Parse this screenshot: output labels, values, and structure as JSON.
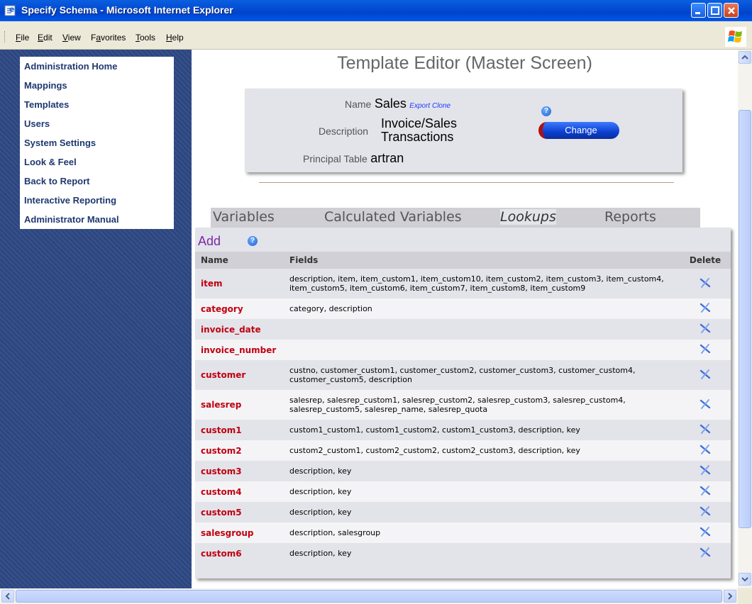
{
  "window": {
    "title": "Specify Schema - Microsoft Internet Explorer"
  },
  "menu": [
    {
      "pre": "",
      "key": "F",
      "post": "ile"
    },
    {
      "pre": "",
      "key": "E",
      "post": "dit"
    },
    {
      "pre": "",
      "key": "V",
      "post": "iew"
    },
    {
      "pre": "F",
      "key": "a",
      "post": "vorites"
    },
    {
      "pre": "",
      "key": "T",
      "post": "ools"
    },
    {
      "pre": "",
      "key": "H",
      "post": "elp"
    }
  ],
  "sidebar": {
    "items": [
      "Administration Home",
      "Mappings",
      "Templates",
      "Users",
      "System Settings",
      "Look & Feel",
      "Back to Report",
      "Interactive Reporting",
      "Administrator Manual"
    ]
  },
  "page": {
    "title": "Template Editor (Master Screen)"
  },
  "info": {
    "name_label": "Name",
    "name_value": "Sales",
    "export_clone": "Export Clone",
    "description_label": "Description",
    "description_line1": "Invoice/Sales",
    "description_line2": "Transactions",
    "principal_label": "Principal Table",
    "principal_value": "artran",
    "help": "?",
    "change_button": "Change"
  },
  "tabs": [
    "Variables",
    "Calculated Variables",
    "Lookups",
    "Reports"
  ],
  "lookups": {
    "add_label": "Add",
    "help": "?",
    "columns": {
      "name": "Name",
      "fields": "Fields",
      "delete": "Delete"
    },
    "rows": [
      {
        "name": "item",
        "fields": "description, item, item_custom1, item_custom10, item_custom2, item_custom3, item_custom4, item_custom5, item_custom6, item_custom7, item_custom8, item_custom9"
      },
      {
        "name": "category",
        "fields": "category, description"
      },
      {
        "name": "invoice_date",
        "fields": ""
      },
      {
        "name": "invoice_number",
        "fields": ""
      },
      {
        "name": "customer",
        "fields": "custno, customer_custom1, customer_custom2, customer_custom3, customer_custom4, customer_custom5, description"
      },
      {
        "name": "salesrep",
        "fields": "salesrep, salesrep_custom1, salesrep_custom2, salesrep_custom3, salesrep_custom4, salesrep_custom5, salesrep_name, salesrep_quota"
      },
      {
        "name": "custom1",
        "fields": "custom1_custom1, custom1_custom2, custom1_custom3, description, key"
      },
      {
        "name": "custom2",
        "fields": "custom2_custom1, custom2_custom2, custom2_custom3, description, key"
      },
      {
        "name": "custom3",
        "fields": "description, key"
      },
      {
        "name": "custom4",
        "fields": "description, key"
      },
      {
        "name": "custom5",
        "fields": "description, key"
      },
      {
        "name": "salesgroup",
        "fields": "description, salesgroup"
      },
      {
        "name": "custom6",
        "fields": "description, key"
      }
    ]
  }
}
